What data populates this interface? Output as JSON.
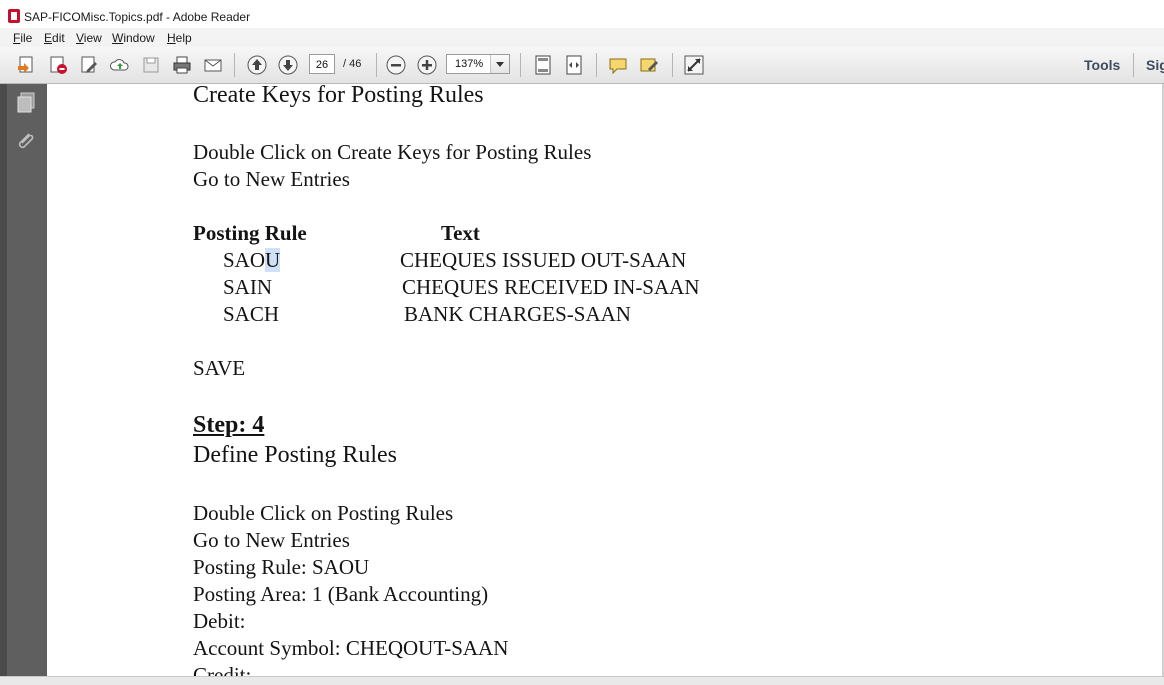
{
  "window": {
    "title": "SAP-FICOMisc.Topics.pdf - Adobe Reader"
  },
  "menu": {
    "items": [
      {
        "label": "File",
        "key": "F",
        "rest": "ile"
      },
      {
        "label": "Edit",
        "key": "E",
        "rest": "dit"
      },
      {
        "label": "View",
        "key": "V",
        "rest": "iew"
      },
      {
        "label": "Window",
        "key": "W",
        "rest": "indow"
      },
      {
        "label": "Help",
        "key": "H",
        "rest": "elp"
      }
    ]
  },
  "toolbar": {
    "page_current": "26",
    "page_total": "/ 46",
    "zoom": "137%",
    "tools_label": "Tools",
    "sign_label": "Sig"
  },
  "document": {
    "heading1": "Create Keys for Posting Rules",
    "instr1": "Double Click on Create Keys for Posting Rules",
    "instr2": "Go to New Entries",
    "col_rule": "Posting Rule",
    "col_text": "Text",
    "rules": [
      {
        "code_a": "SAO",
        "code_hl": "U",
        "text": "CHEQUES ISSUED OUT-SAAN"
      },
      {
        "code": "SAIN",
        "text": "CHEQUES RECEIVED IN-SAAN"
      },
      {
        "code": "SACH",
        "text": "BANK CHARGES-SAAN"
      }
    ],
    "save": "SAVE",
    "step": "Step: 4",
    "heading2": "Define Posting Rules",
    "line1": "Double Click on Posting Rules",
    "line2": "Go to New Entries",
    "line3": "Posting Rule: SAOU",
    "line4": "Posting Area: 1 (Bank Accounting)",
    "line5": "Debit:",
    "line6": "Account Symbol:  CHEQOUT-SAAN",
    "line7": "Credit:"
  }
}
